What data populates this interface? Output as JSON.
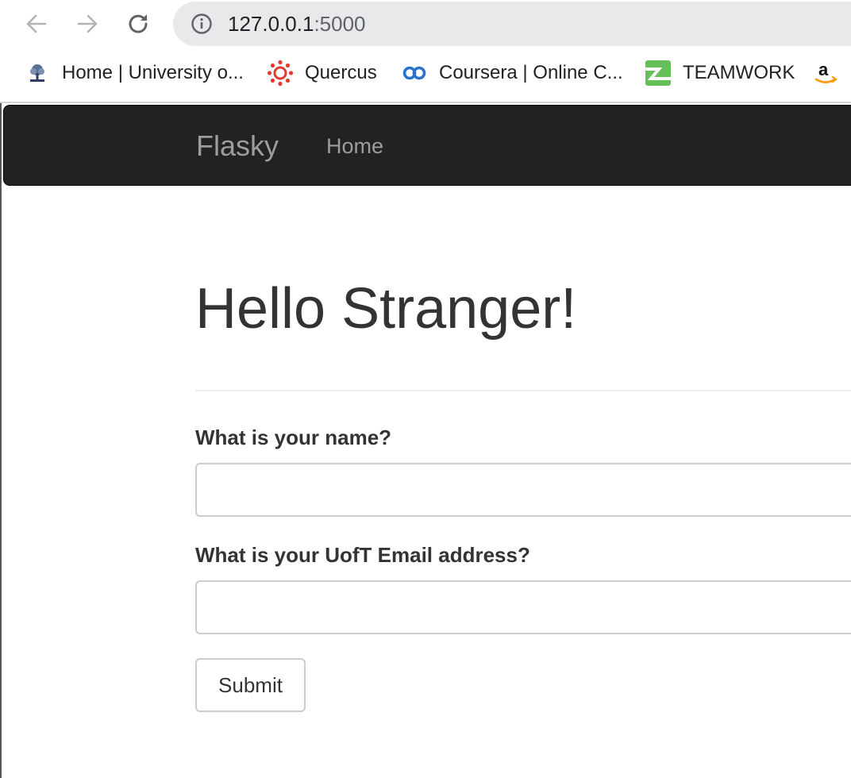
{
  "toolbar": {
    "url_host": "127.0.0.1",
    "url_port": ":5000",
    "back_icon": "arrow-left-icon",
    "forward_icon": "arrow-right-icon",
    "reload_icon": "reload-icon",
    "info_icon": "info-icon"
  },
  "bookmarks": [
    {
      "label": "Home | University o...",
      "icon": "uoft-crest-icon"
    },
    {
      "label": "Quercus",
      "icon": "quercus-icon"
    },
    {
      "label": "Coursera | Online C...",
      "icon": "coursera-icon"
    },
    {
      "label": "TEAMWORK",
      "icon": "teamwork-icon"
    },
    {
      "label": "",
      "icon": "amazon-icon"
    }
  ],
  "navbar": {
    "brand": "Flasky",
    "home": "Home",
    "background": "#222222",
    "link_color": "#9d9d9d"
  },
  "page": {
    "heading": "Hello Stranger!"
  },
  "form": {
    "name_label": "What is your name?",
    "name_value": "",
    "email_label": "What is your UofT Email address?",
    "email_value": "",
    "submit_label": "Submit"
  }
}
